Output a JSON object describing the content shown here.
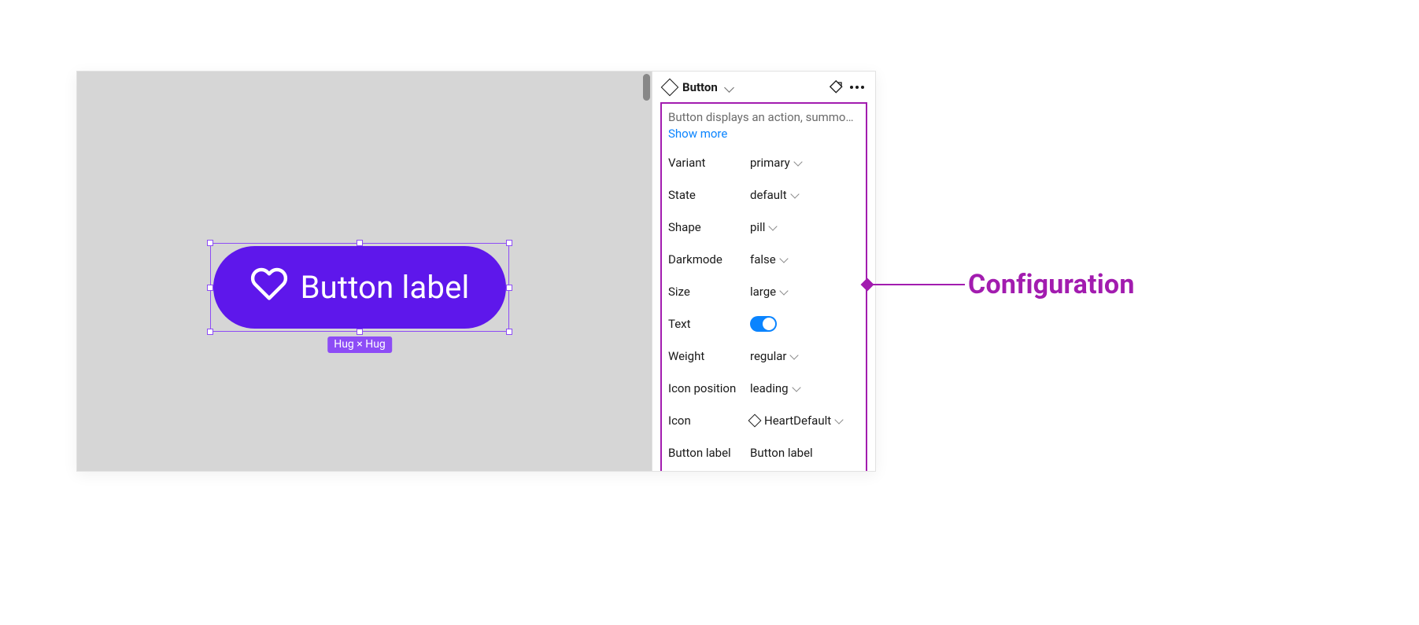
{
  "canvas": {
    "selection_size_badge": "Hug × Hug",
    "preview_label": "Button label"
  },
  "inspector": {
    "component_name": "Button",
    "description": "Button displays an action, summons ...",
    "show_more_label": "Show more",
    "properties": [
      {
        "label": "Variant",
        "type": "select",
        "value": "primary"
      },
      {
        "label": "State",
        "type": "select",
        "value": "default"
      },
      {
        "label": "Shape",
        "type": "select",
        "value": "pill"
      },
      {
        "label": "Darkmode",
        "type": "select",
        "value": "false"
      },
      {
        "label": "Size",
        "type": "select",
        "value": "large"
      },
      {
        "label": "Text",
        "type": "toggle",
        "value": "on"
      },
      {
        "label": "Weight",
        "type": "select",
        "value": "regular"
      },
      {
        "label": "Icon position",
        "type": "select",
        "value": "leading"
      },
      {
        "label": "Icon",
        "type": "instance",
        "value": "HeartDefault"
      },
      {
        "label": "Button label",
        "type": "text",
        "value": "Button label"
      }
    ]
  },
  "annotation": {
    "label": "Configuration"
  },
  "colors": {
    "brand_purple": "#5e17eb",
    "selection_purple": "#8d4cf6",
    "accent_blue": "#0a84ff",
    "annotation_magenta": "#a21caf"
  }
}
